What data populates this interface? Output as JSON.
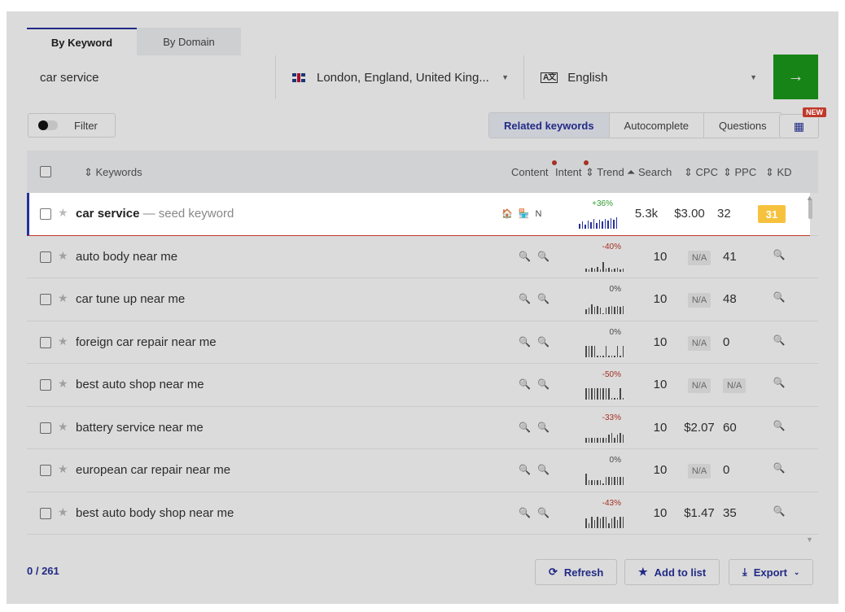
{
  "tabs": [
    {
      "label": "By Keyword"
    },
    {
      "label": "By Domain"
    }
  ],
  "search": {
    "query": "car service",
    "location": "London, England, United King...",
    "language": "English",
    "go_icon": "arrow-right-icon"
  },
  "filter": {
    "label": "Filter"
  },
  "view_tabs": [
    {
      "label": "Related keywords",
      "active": true
    },
    {
      "label": "Autocomplete",
      "active": false
    },
    {
      "label": "Questions",
      "active": false
    }
  ],
  "columns_badge": "NEW",
  "table": {
    "headers": {
      "keywords": "⇕ Keywords",
      "content": "Content",
      "intent": "Intent",
      "trend": "⇕ Trend",
      "search": "⏶ Search",
      "cpc": "⇕ CPC",
      "ppc": "⇕ PPC",
      "kd": "⇕ KD"
    },
    "seed": {
      "keyword": "car service",
      "suffix": " — seed keyword",
      "intent_icons": "🏠 🏪 N",
      "trend": "+36%",
      "trend_color": "#2e9b2e",
      "spark": [
        6,
        9,
        5,
        10,
        8,
        12,
        7,
        11,
        9,
        12,
        10,
        13,
        11,
        14
      ],
      "search": "5.3k",
      "cpc": "$3.00",
      "ppc": "32",
      "kd": "31",
      "kd_color": "#f6c23e"
    },
    "rows": [
      {
        "keyword": "auto body near me",
        "trend": "-40%",
        "trend_color": "#c0392b",
        "spark": [
          4,
          3,
          5,
          4,
          6,
          3,
          12,
          4,
          5,
          3,
          4,
          5,
          3,
          4
        ],
        "search": "10",
        "cpc": "N/A",
        "ppc": "41"
      },
      {
        "keyword": "car tune up near me",
        "trend": "0%",
        "trend_color": "#555555",
        "spark": [
          6,
          8,
          12,
          9,
          10,
          8,
          0,
          8,
          9,
          10,
          9,
          10,
          9,
          10
        ],
        "search": "10",
        "cpc": "N/A",
        "ppc": "48"
      },
      {
        "keyword": "foreign car repair near me",
        "trend": "0%",
        "trend_color": "#555555",
        "spark": [
          14,
          14,
          14,
          14,
          2,
          2,
          2,
          14,
          2,
          2,
          2,
          14,
          2,
          14
        ],
        "search": "10",
        "cpc": "N/A",
        "ppc": "0"
      },
      {
        "keyword": "best auto shop near me",
        "trend": "-50%",
        "trend_color": "#c0392b",
        "spark": [
          14,
          14,
          14,
          14,
          14,
          14,
          14,
          14,
          14,
          2,
          2,
          2,
          14,
          2
        ],
        "search": "10",
        "cpc": "N/A",
        "ppc": "N/A"
      },
      {
        "keyword": "battery service near me",
        "trend": "-33%",
        "trend_color": "#c0392b",
        "spark": [
          6,
          6,
          6,
          6,
          6,
          6,
          6,
          6,
          10,
          12,
          6,
          10,
          12,
          10
        ],
        "search": "10",
        "cpc": "$2.07",
        "ppc": "60"
      },
      {
        "keyword": "european car repair near me",
        "trend": "0%",
        "trend_color": "#555555",
        "spark": [
          14,
          6,
          6,
          6,
          6,
          6,
          2,
          10,
          10,
          10,
          10,
          10,
          10,
          10
        ],
        "search": "10",
        "cpc": "N/A",
        "ppc": "0"
      },
      {
        "keyword": "best auto body shop near me",
        "trend": "-43%",
        "trend_color": "#c0392b",
        "spark": [
          12,
          6,
          14,
          10,
          14,
          12,
          14,
          14,
          6,
          12,
          14,
          10,
          14,
          14
        ],
        "search": "10",
        "cpc": "$1.47",
        "ppc": "35"
      }
    ]
  },
  "footer": {
    "counter": "0 / 261",
    "refresh": "Refresh",
    "add_to_list": "Add to list",
    "export": "Export"
  }
}
